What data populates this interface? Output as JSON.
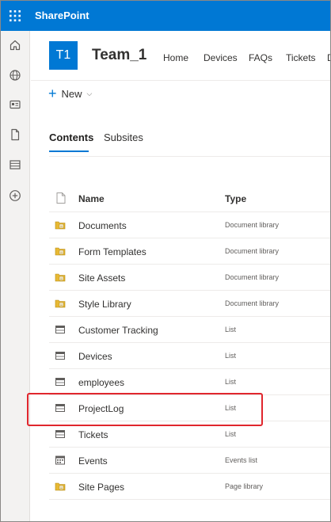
{
  "suite_bar": {
    "app_name": "SharePoint",
    "color": "#0078d4"
  },
  "left_rail": {
    "items": [
      {
        "icon": "home-icon"
      },
      {
        "icon": "globe-icon"
      },
      {
        "icon": "news-icon"
      },
      {
        "icon": "document-icon"
      },
      {
        "icon": "list-icon"
      },
      {
        "icon": "add-circle-icon"
      }
    ]
  },
  "site": {
    "logo_text": "T1",
    "title": "Team_1",
    "nav": [
      "Home",
      "Devices",
      "FAQs",
      "Tickets",
      "D"
    ]
  },
  "command_bar": {
    "new_label": "New"
  },
  "tabs": [
    {
      "label": "Contents",
      "active": true
    },
    {
      "label": "Subsites",
      "active": false
    }
  ],
  "list": {
    "columns": {
      "name": "Name",
      "type": "Type"
    },
    "rows": [
      {
        "name": "Documents",
        "type": "Document library",
        "icon": "library-icon"
      },
      {
        "name": "Form Templates",
        "type": "Document library",
        "icon": "library-icon"
      },
      {
        "name": "Site Assets",
        "type": "Document library",
        "icon": "library-icon"
      },
      {
        "name": "Style Library",
        "type": "Document library",
        "icon": "library-icon"
      },
      {
        "name": "Customer Tracking",
        "type": "List",
        "icon": "list-icon"
      },
      {
        "name": "Devices",
        "type": "List",
        "icon": "list-icon"
      },
      {
        "name": "employees",
        "type": "List",
        "icon": "list-icon"
      },
      {
        "name": "ProjectLog",
        "type": "List",
        "icon": "list-icon",
        "highlighted": true
      },
      {
        "name": "Tickets",
        "type": "List",
        "icon": "list-icon"
      },
      {
        "name": "Events",
        "type": "Events list",
        "icon": "calendar-icon"
      },
      {
        "name": "Site Pages",
        "type": "Page library",
        "icon": "library-icon"
      }
    ]
  },
  "colors": {
    "accent": "#0078d4",
    "highlight": "#e0262d",
    "folder": "#c19c00"
  }
}
